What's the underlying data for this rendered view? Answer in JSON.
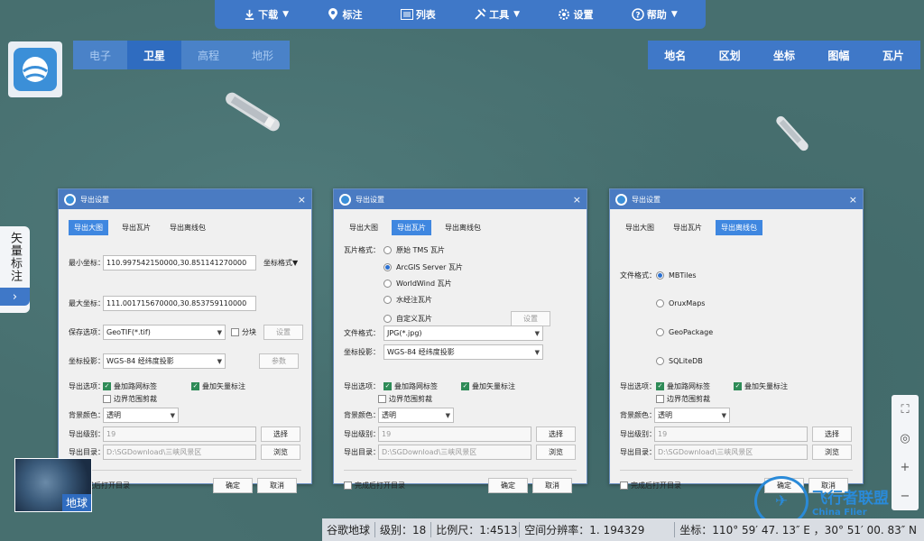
{
  "toolbar": {
    "items": [
      {
        "label": "下载",
        "icon": "download-icon",
        "dropdown": true
      },
      {
        "label": "标注",
        "icon": "location-pin-icon",
        "dropdown": false
      },
      {
        "label": "列表",
        "icon": "list-icon",
        "dropdown": false
      },
      {
        "label": "工具",
        "icon": "tools-icon",
        "dropdown": true
      },
      {
        "label": "设置",
        "icon": "gear-icon",
        "dropdown": false
      },
      {
        "label": "帮助",
        "icon": "help-icon",
        "dropdown": true
      }
    ]
  },
  "map_types": [
    "电子",
    "卫星",
    "高程",
    "地形"
  ],
  "map_type_active": "卫星",
  "right_nav": [
    "地名",
    "区划",
    "坐标",
    "图幅",
    "瓦片"
  ],
  "vector_tab": {
    "label": "矢量标注",
    "arrow": "›"
  },
  "earth_button": {
    "label": "地球"
  },
  "zoom": {
    "fullscreen": "⛶",
    "locate": "◎",
    "zoom_in": "+",
    "zoom_out": "−"
  },
  "statusbar": {
    "source": "谷歌地球",
    "level": "级别：18",
    "scale": "比例尺：1:4513",
    "resolution": "空间分辨率：1. 194329",
    "coords": "坐标：110° 59′ 47. 13″ E ，30° 51′ 00. 83″ N"
  },
  "watermark": {
    "text": "飞行者联盟",
    "subtext": "China Flier"
  },
  "dialog_common": {
    "title": "导出设置",
    "close": "×",
    "tabs": [
      "导出大图",
      "导出瓦片",
      "导出离线包"
    ],
    "export_options_label": "导出选项：",
    "opt_road": "叠加路网标签",
    "opt_vector": "叠加矢量标注",
    "opt_boundary": "边界范围剪裁",
    "bg_label": "背景颜色：",
    "bg_value": "透明",
    "level_label": "导出级别：",
    "level_value": "19",
    "select_btn": "选择",
    "dir_label": "导出目录：",
    "dir_value": "D:\\SGDownload\\三峡风景区",
    "browse_btn": "浏览",
    "open_after": "完成后打开目录",
    "ok": "确定",
    "cancel": "取消",
    "projection_label": "坐标投影：",
    "projection_value": "WGS-84 经纬度投影"
  },
  "dialog1": {
    "min_label": "最小坐标：",
    "min_value": "110.997542150000,30.851141270000",
    "coord_format": "坐标格式▼",
    "max_label": "最大坐标：",
    "max_value": "111.001715670000,30.853759110000",
    "save_label": "保存选项：",
    "save_value": "GeoTIF(*.tif)",
    "split_label": "分块",
    "settings_btn": "设置",
    "params_btn": "参数"
  },
  "dialog2": {
    "tile_format_label": "瓦片格式：",
    "tile_options": [
      "原始 TMS 瓦片",
      "ArcGIS Server 瓦片",
      "WorldWind 瓦片",
      "水经注瓦片",
      "自定义瓦片"
    ],
    "tile_selected": 1,
    "settings_btn": "设置",
    "file_format_label": "文件格式：",
    "file_format_value": "JPG(*.jpg)"
  },
  "dialog3": {
    "file_format_label": "文件格式：",
    "options": [
      "MBTiles",
      "OruxMaps",
      "GeoPackage",
      "SQLiteDB"
    ],
    "selected": 0
  }
}
